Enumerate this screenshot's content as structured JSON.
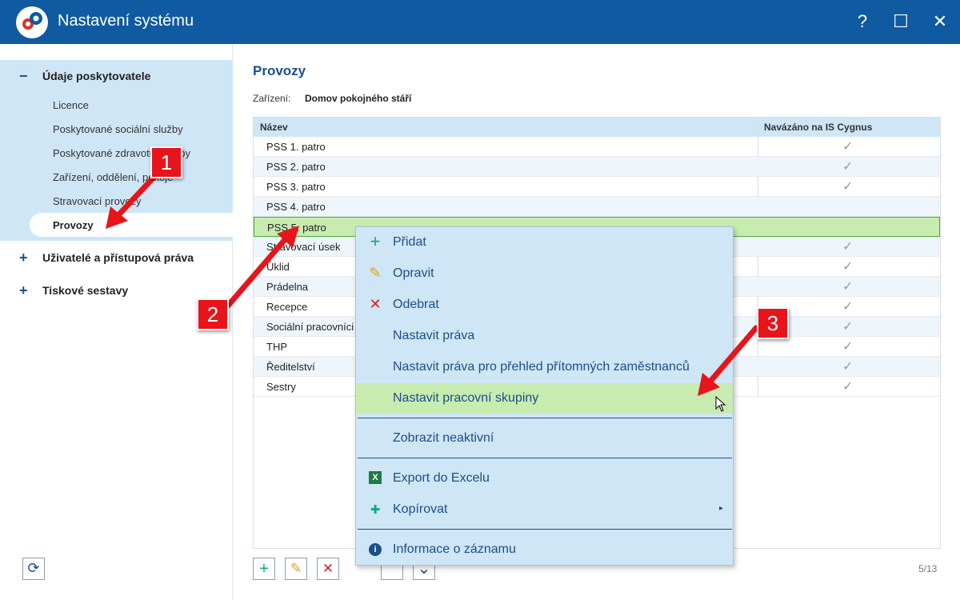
{
  "window": {
    "title": "Nastavení systému",
    "help": "?",
    "maximize": "☐",
    "close": "✕"
  },
  "sidebar": {
    "section": {
      "sign": "−",
      "label": "Údaje poskytovatele"
    },
    "items": [
      "Licence",
      "Poskytované sociální služby",
      "Poskytované zdravotní služby",
      "Zařízení, oddělení, pokoje",
      "Stravovací provozy"
    ],
    "active": "Provozy",
    "other_sections": [
      {
        "sign": "+",
        "label": "Uživatelé a přístupová práva"
      },
      {
        "sign": "+",
        "label": "Tiskové sestavy"
      }
    ],
    "refresh": "⟳"
  },
  "main": {
    "title": "Provozy",
    "facility_label": "Zařízení:",
    "facility_value": "Domov pokojného stáří",
    "columns": [
      "Název",
      "Navázáno na IS Cygnus"
    ],
    "rows": [
      {
        "name": "PSS 1. patro",
        "check": "✓"
      },
      {
        "name": "PSS 2. patro",
        "check": "✓"
      },
      {
        "name": "PSS 3. patro",
        "check": "✓"
      },
      {
        "name": "PSS 4. patro",
        "check": ""
      },
      {
        "name": "PSS 5. patro",
        "check": ""
      },
      {
        "name": "Stravovací úsek",
        "check": "✓"
      },
      {
        "name": "Úklid",
        "check": "✓"
      },
      {
        "name": "Prádelna",
        "check": "✓"
      },
      {
        "name": "Recepce",
        "check": "✓"
      },
      {
        "name": "Sociální pracovníci",
        "check": "✓"
      },
      {
        "name": "THP",
        "check": "✓"
      },
      {
        "name": "Ředitelství",
        "check": "✓"
      },
      {
        "name": "Sestry",
        "check": "✓"
      }
    ],
    "pager": "5/13",
    "buttons": {
      "add": "+",
      "edit": "✎",
      "delete": "✕",
      "up": "⌃",
      "down": "⌄"
    }
  },
  "context_menu": {
    "items": [
      {
        "icon": "+",
        "label": "Přidat"
      },
      {
        "icon": "✎",
        "label": "Opravit"
      },
      {
        "icon": "✕",
        "label": "Odebrat"
      },
      {
        "icon": "",
        "label": "Nastavit práva"
      },
      {
        "icon": "",
        "label": "Nastavit práva pro přehled přítomných zaměstnanců"
      },
      {
        "icon": "",
        "label": "Nastavit pracovní skupiny"
      },
      {
        "icon": "",
        "label": "Zobrazit neaktivní"
      },
      {
        "icon": "X",
        "label": "Export do Excelu"
      },
      {
        "icon": "✚",
        "label": "Kopírovat",
        "arrow": "▸"
      },
      {
        "icon": "i",
        "label": "Informace o záznamu"
      }
    ]
  },
  "annotations": [
    "1",
    "2",
    "3"
  ],
  "colors": {
    "titlebar": "#0f5aa0",
    "accent": "#1a4f8a",
    "selection": "#c8ecb0",
    "badge": "#e8141b"
  }
}
